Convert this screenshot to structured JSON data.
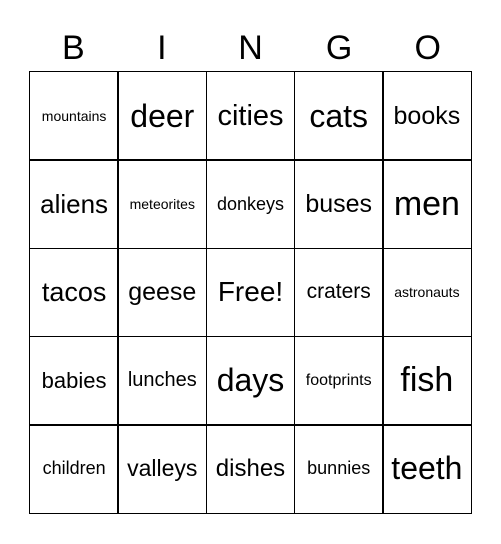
{
  "header": {
    "letters": [
      "B",
      "I",
      "N",
      "G",
      "O"
    ]
  },
  "board": {
    "rows": [
      [
        "mountains",
        "deer",
        "cities",
        "cats",
        "books"
      ],
      [
        "aliens",
        "meteorites",
        "donkeys",
        "buses",
        "men"
      ],
      [
        "tacos",
        "geese",
        "Free!",
        "craters",
        "astronauts"
      ],
      [
        "babies",
        "lunches",
        "days",
        "footprints",
        "fish"
      ],
      [
        "children",
        "valleys",
        "dishes",
        "bunnies",
        "teeth"
      ]
    ]
  }
}
